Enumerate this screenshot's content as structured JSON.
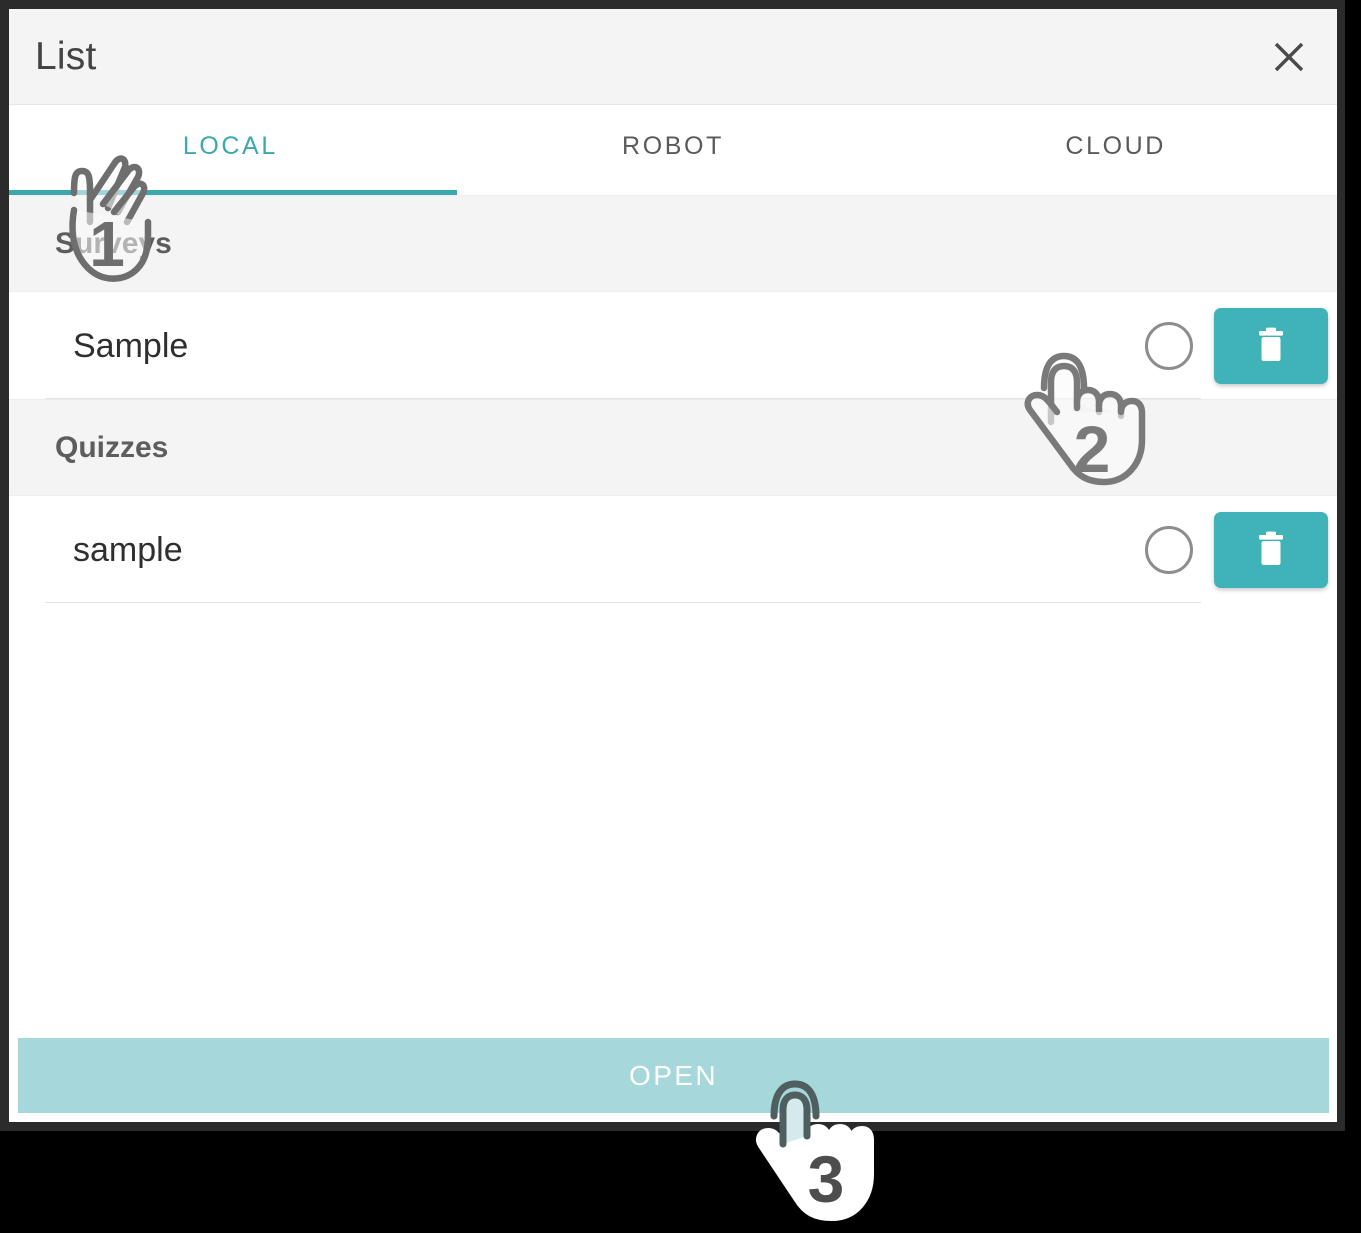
{
  "window": {
    "title": "List",
    "close_icon": "close-icon"
  },
  "tabs": [
    {
      "label": "LOCAL",
      "active": true
    },
    {
      "label": "ROBOT",
      "active": false
    },
    {
      "label": "CLOUD",
      "active": false
    }
  ],
  "sections": [
    {
      "header": "Surveys",
      "rows": [
        {
          "label": "Sample",
          "selected": false,
          "delete_icon": "trash-icon"
        }
      ]
    },
    {
      "header": "Quizzes",
      "rows": [
        {
          "label": "sample",
          "selected": false,
          "delete_icon": "trash-icon"
        }
      ]
    }
  ],
  "footer": {
    "open_label": "OPEN"
  },
  "annotations": [
    {
      "number": "1",
      "icon": "hand-pointer-icon",
      "target": "tab-local"
    },
    {
      "number": "2",
      "icon": "hand-pointer-icon",
      "target": "radio-sample-survey"
    },
    {
      "number": "3",
      "icon": "hand-pointer-icon",
      "target": "open-button"
    }
  ],
  "colors": {
    "accent": "#3aa8ad",
    "delete_button": "#3fb3b8",
    "open_bar": "#a5d7db",
    "header_bg": "#f4f4f4",
    "frame": "#2b2b2b"
  }
}
